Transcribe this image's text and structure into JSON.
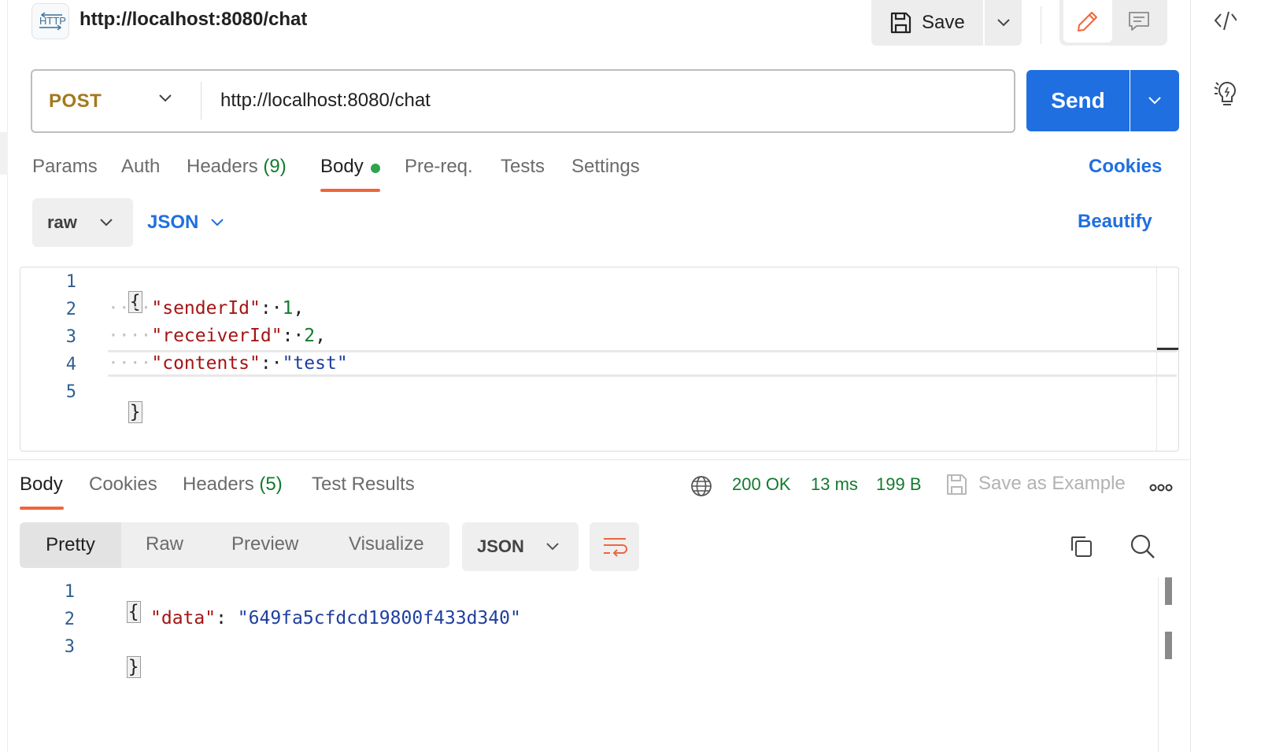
{
  "header": {
    "badge_text": "HTTP",
    "request_title": "http://localhost:8080/chat",
    "save_label": "Save"
  },
  "request": {
    "method": "POST",
    "url": "http://localhost:8080/chat",
    "send_label": "Send"
  },
  "request_tabs": {
    "params": "Params",
    "auth": "Auth",
    "headers_label": "Headers",
    "headers_count": "(9)",
    "body": "Body",
    "prereq": "Pre-req.",
    "tests": "Tests",
    "settings": "Settings",
    "cookies": "Cookies"
  },
  "body_options": {
    "mode": "raw",
    "language": "JSON",
    "beautify": "Beautify"
  },
  "request_body": {
    "line_numbers": [
      "1",
      "2",
      "3",
      "4",
      "5"
    ],
    "open_brace": "{",
    "close_brace": "}",
    "indent": "····",
    "sep": ":·",
    "comma": ",",
    "sender_key": "\"senderId\"",
    "sender_value": "1",
    "receiver_key": "\"receiverId\"",
    "receiver_value": "2",
    "contents_key": "\"contents\"",
    "contents_value": "\"test\""
  },
  "response_tabs": {
    "body": "Body",
    "cookies": "Cookies",
    "headers_label": "Headers",
    "headers_count": "(5)",
    "test_results": "Test Results"
  },
  "response_status": {
    "status": "200 OK",
    "time": "13 ms",
    "size": "199 B",
    "save_example": "Save as Example"
  },
  "response_view": {
    "pretty": "Pretty",
    "raw": "Raw",
    "preview": "Preview",
    "visualize": "Visualize",
    "language": "JSON"
  },
  "response_body": {
    "line_numbers": [
      "1",
      "2",
      "3"
    ],
    "open_brace": "{",
    "close_brace": "}",
    "data_key": "\"data\"",
    "sep": ": ",
    "data_value": "\"649fa5cfdcd19800f433d340\""
  },
  "colors": {
    "accent_blue": "#1f6fe0",
    "method_post": "#a3791c",
    "tab_active": "#f0653b",
    "success_green": "#137a2e"
  },
  "icons": {
    "badge": "http-request-icon",
    "save": "floppy-disk-icon",
    "edit": "pencil-icon",
    "comment": "comment-icon",
    "globe": "globe-icon",
    "more": "more-dots-icon",
    "wrap": "text-wrap-icon",
    "copy": "copy-icon",
    "search": "search-icon",
    "code": "code-icon",
    "bulb": "lightbulb-icon"
  }
}
